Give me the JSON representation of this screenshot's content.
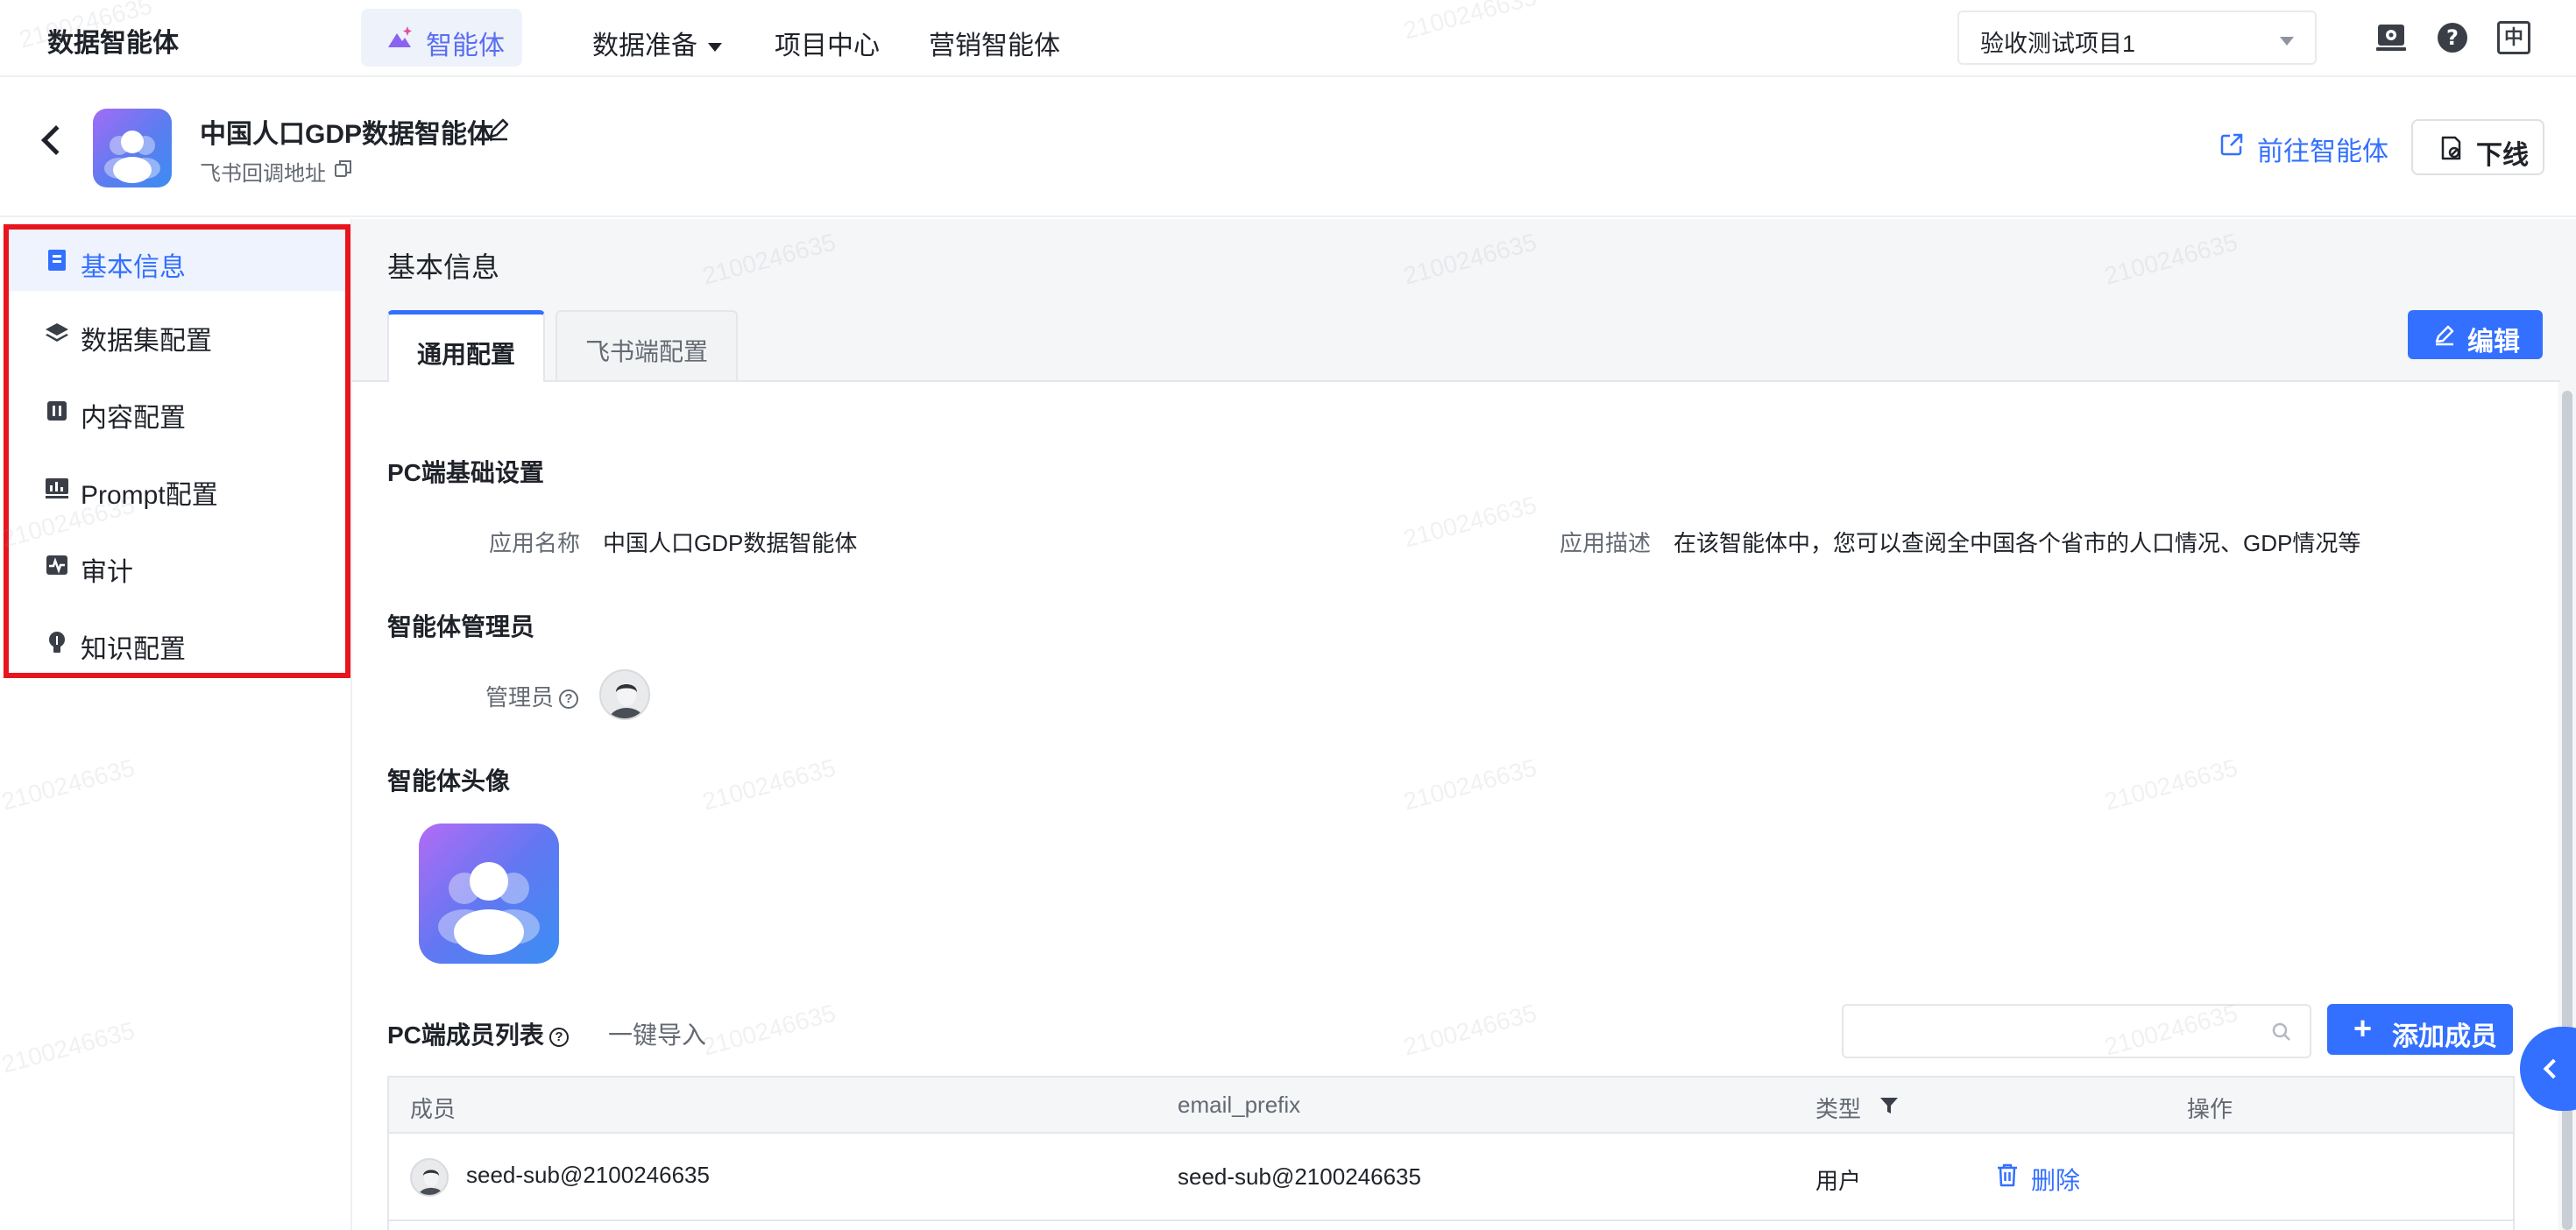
{
  "topbar": {
    "brand": "数据智能体",
    "nav": [
      {
        "label": "智能体",
        "active": true
      },
      {
        "label": "数据准备",
        "dropdown": true
      },
      {
        "label": "项目中心"
      },
      {
        "label": "营销智能体"
      }
    ],
    "project_select": "验收测试项目1",
    "right_icons": [
      "settings-icon",
      "help-icon",
      "language-icon"
    ],
    "language_glyph": "中"
  },
  "header": {
    "agent_name": "中国人口GDP数据智能体",
    "callback_label": "飞书回调地址",
    "goto_label": "前往智能体",
    "offline_label": "下线"
  },
  "sidebar": {
    "items": [
      {
        "label": "基本信息",
        "icon": "info-doc-icon",
        "active": true
      },
      {
        "label": "数据集配置",
        "icon": "layers-icon"
      },
      {
        "label": "内容配置",
        "icon": "content-icon"
      },
      {
        "label": "Prompt配置",
        "icon": "chart-monitor-icon"
      },
      {
        "label": "审计",
        "icon": "audit-pulse-icon"
      },
      {
        "label": "知识配置",
        "icon": "bulb-icon"
      }
    ]
  },
  "main": {
    "section_title": "基本信息",
    "tabs": [
      {
        "label": "通用配置",
        "active": true
      },
      {
        "label": "飞书端配置"
      }
    ],
    "edit_label": "编辑",
    "pc_basic": {
      "title": "PC端基础设置",
      "app_name_label": "应用名称",
      "app_name_value": "中国人口GDP数据智能体",
      "app_desc_label": "应用描述",
      "app_desc_value": "在该智能体中，您可以查阅全中国各个省市的人口情况、GDP情况等"
    },
    "admin": {
      "title": "智能体管理员",
      "label": "管理员"
    },
    "avatar_section": {
      "title": "智能体头像"
    },
    "members": {
      "title": "PC端成员列表",
      "import_label": "一键导入",
      "search_placeholder": "",
      "add_label": "添加成员",
      "columns": [
        "成员",
        "email_prefix",
        "类型",
        "操作"
      ],
      "rows": [
        {
          "member": "seed-sub@2100246635",
          "email_prefix": "seed-sub@2100246635",
          "type": "用户",
          "action": "删除"
        }
      ]
    }
  },
  "colors": {
    "primary": "#3370ff",
    "highlight_box": "#e8151f",
    "avatar_gradient_start": "#a36bf6",
    "avatar_gradient_end": "#3d8cf2"
  },
  "watermark_text": "2100246635"
}
